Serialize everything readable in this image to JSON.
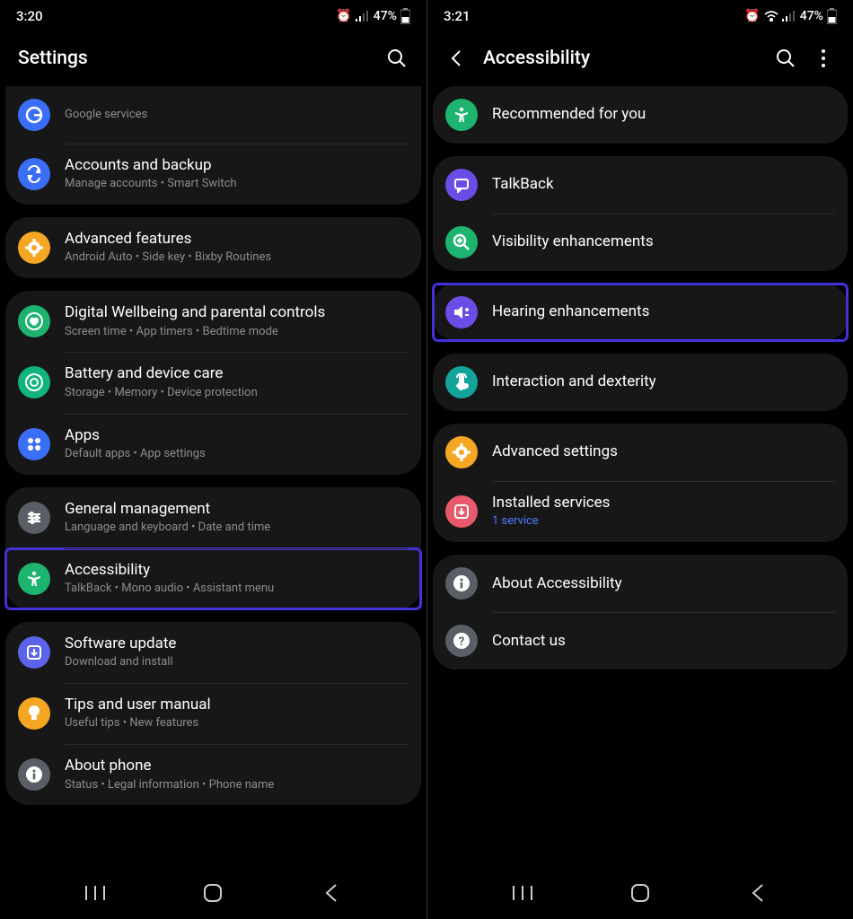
{
  "left": {
    "status": {
      "time": "3:20",
      "battery": "47%"
    },
    "header": {
      "title": "Settings"
    },
    "groups": [
      {
        "firstCut": true,
        "rows": [
          {
            "icon_bg": "#3b6ef6",
            "icon": "google",
            "title": "",
            "sub": "Google services"
          },
          {
            "icon_bg": "#3b6ef6",
            "icon": "sync",
            "title": "Accounts and backup",
            "sub": "Manage accounts  •  Smart Switch"
          }
        ]
      },
      {
        "rows": [
          {
            "icon_bg": "#f5a623",
            "icon": "gear-plus",
            "title": "Advanced features",
            "sub": "Android Auto  •  Side key  •  Bixby Routines"
          }
        ]
      },
      {
        "rows": [
          {
            "icon_bg": "#1db46f",
            "icon": "heart-ring",
            "title": "Digital Wellbeing and parental controls",
            "sub": "Screen time  •  App timers  •  Bedtime mode"
          },
          {
            "icon_bg": "#0fb57a",
            "icon": "battery-ring",
            "title": "Battery and device care",
            "sub": "Storage   •   Memory   •   Device protection"
          },
          {
            "icon_bg": "#3b6ef6",
            "icon": "grid4",
            "title": "Apps",
            "sub": "Default apps  •  App settings"
          }
        ]
      },
      {
        "rows": [
          {
            "icon_bg": "#5a5e66",
            "icon": "sliders",
            "title": "General management",
            "sub": "Language and keyboard   •   Date and time"
          },
          {
            "icon_bg": "#1db46f",
            "icon": "accessibility",
            "title": "Accessibility",
            "sub": "TalkBack  •  Mono audio  •  Assistant menu",
            "highlight": true
          }
        ]
      },
      {
        "rows": [
          {
            "icon_bg": "#5b63e8",
            "icon": "download-box",
            "title": "Software update",
            "sub": "Download and install"
          },
          {
            "icon_bg": "#f5a623",
            "icon": "bulb",
            "title": "Tips and user manual",
            "sub": "Useful tips  •  New features"
          },
          {
            "icon_bg": "#5a5e66",
            "icon": "info",
            "title": "About phone",
            "sub": "Status  •  Legal information  •  Phone name"
          }
        ]
      }
    ]
  },
  "right": {
    "status": {
      "time": "3:21",
      "battery": "47%"
    },
    "header": {
      "title": "Accessibility",
      "back": true,
      "more": true
    },
    "groups": [
      {
        "rows": [
          {
            "icon_bg": "#1db46f",
            "icon": "accessibility",
            "title": "Recommended for you"
          }
        ]
      },
      {
        "rows": [
          {
            "icon_bg": "#6b4de6",
            "icon": "speech",
            "title": "TalkBack"
          },
          {
            "icon_bg": "#1db46f",
            "icon": "zoom-plus",
            "title": "Visibility enhancements"
          }
        ]
      },
      {
        "rows": [
          {
            "icon_bg": "#6b4de6",
            "icon": "volume",
            "title": "Hearing enhancements",
            "highlight": true
          }
        ]
      },
      {
        "rows": [
          {
            "icon_bg": "#14a39a",
            "icon": "tap",
            "title": "Interaction and dexterity"
          }
        ]
      },
      {
        "rows": [
          {
            "icon_bg": "#f5a623",
            "icon": "gear-plus",
            "title": "Advanced settings"
          },
          {
            "icon_bg": "#e85a6b",
            "icon": "download-box",
            "title": "Installed services",
            "sub": "1 service",
            "sub_link": true
          }
        ]
      },
      {
        "rows": [
          {
            "icon_bg": "#5a5e66",
            "icon": "info",
            "title": "About Accessibility"
          },
          {
            "icon_bg": "#5a5e66",
            "icon": "question",
            "title": "Contact us"
          }
        ]
      }
    ]
  }
}
